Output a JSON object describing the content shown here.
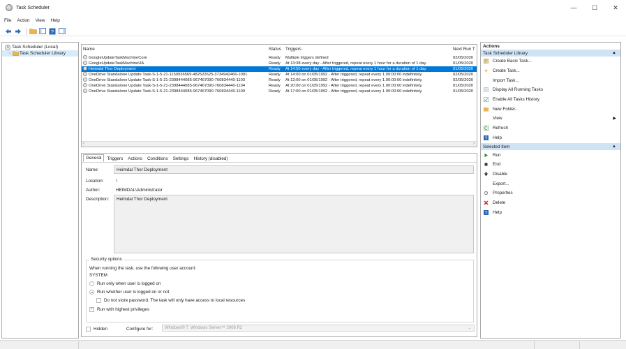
{
  "window": {
    "title": "Task Scheduler",
    "minimize": "—",
    "maximize": "☐",
    "close": "✕"
  },
  "menu": [
    "File",
    "Action",
    "View",
    "Help"
  ],
  "tree": {
    "root": "Task Scheduler (Local)",
    "library": "Task Scheduler Library"
  },
  "task_list": {
    "columns": {
      "name": "Name",
      "status": "Status",
      "triggers": "Triggers",
      "next_run": "Next Run T"
    },
    "rows": [
      {
        "name": "GoogleUpdateTaskMachineCore",
        "status": "Ready",
        "triggers": "Multiple triggers defined",
        "next_run": "02/05/2020"
      },
      {
        "name": "GoogleUpdateTaskMachineUA",
        "status": "Ready",
        "triggers": "At 13:38 every day - After triggered, repeat every 1 hour for a duration of 1 day.",
        "next_run": "01/05/2020"
      },
      {
        "name": "Heimdal Thor Deployment",
        "status": "Ready",
        "triggers": "At 14:50 every day - After triggered, repeat every 1 hour for a duration of 1 day.",
        "next_run": "01/05/2020"
      },
      {
        "name": "OneDrive Standalone Update Task-S-1-5-21-1150936569-482522625-3734942466-1001",
        "status": "Ready",
        "triggers": "At 14:00 on 01/05/1992 - After triggered, repeat every 1.00:00:00 indefinitely.",
        "next_run": "02/05/2020"
      },
      {
        "name": "OneDrive Standalone Update Task-S-1-5-21-2398444085-967467090-760834440-1103",
        "status": "Ready",
        "triggers": "At 12:00 on 01/05/1992 - After triggered, repeat every 1.00:00:00 indefinitely.",
        "next_run": "02/05/2020"
      },
      {
        "name": "OneDrive Standalone Update Task-S-1-5-21-2398444085-967467090-760834440-1104",
        "status": "Ready",
        "triggers": "At 20:00 on 01/05/1992 - After triggered, repeat every 1.00:00:00 indefinitely.",
        "next_run": "01/05/2020"
      },
      {
        "name": "OneDrive Standalone Update Task-S-1-5-21-2398444085-967467090-760834440-1109",
        "status": "Ready",
        "triggers": "At 17:00 on 01/05/1992 - After triggered, repeat every 1.00:00:00 indefinitely.",
        "next_run": "01/05/2020"
      }
    ]
  },
  "details": {
    "tabs": [
      "General",
      "Triggers",
      "Actions",
      "Conditions",
      "Settings",
      "History (disabled)"
    ],
    "name_label": "Name:",
    "name_value": "Heimdal Thor Deployment",
    "location_label": "Location:",
    "location_value": "\\",
    "author_label": "Author:",
    "author_value": "HEIMDAL\\Administrator",
    "description_label": "Description:",
    "description_value": "Heimdal Thor Deployment",
    "security": {
      "title": "Security options",
      "account_prompt": "When running the task, use the following user account:",
      "account": "SYSTEM",
      "run_logged_on": "Run only when user is logged on",
      "run_whether": "Run whether user is logged on or not",
      "no_store_password": "Do not store password.  The task will only have access to local resources",
      "highest_privileges": "Run with highest privileges"
    },
    "hidden_label": "Hidden",
    "configure_label": "Configure for:",
    "configure_value": "Windows® 7, Windows Server™ 2008 R2"
  },
  "actions": {
    "header": "Actions",
    "library_section": "Task Scheduler Library",
    "library_items": [
      "Create Basic Task...",
      "Create Task...",
      "Import Task...",
      "Display All Running Tasks",
      "Enable All Tasks History",
      "New Folder...",
      "View",
      "Refresh",
      "Help"
    ],
    "selected_section": "Selected Item",
    "selected_items": [
      "Run",
      "End",
      "Disable",
      "Export...",
      "Properties",
      "Delete",
      "Help"
    ]
  },
  "colors": {
    "selection": "#0078d7",
    "section": "#cfe3f5",
    "folder": "#e8b84a"
  }
}
